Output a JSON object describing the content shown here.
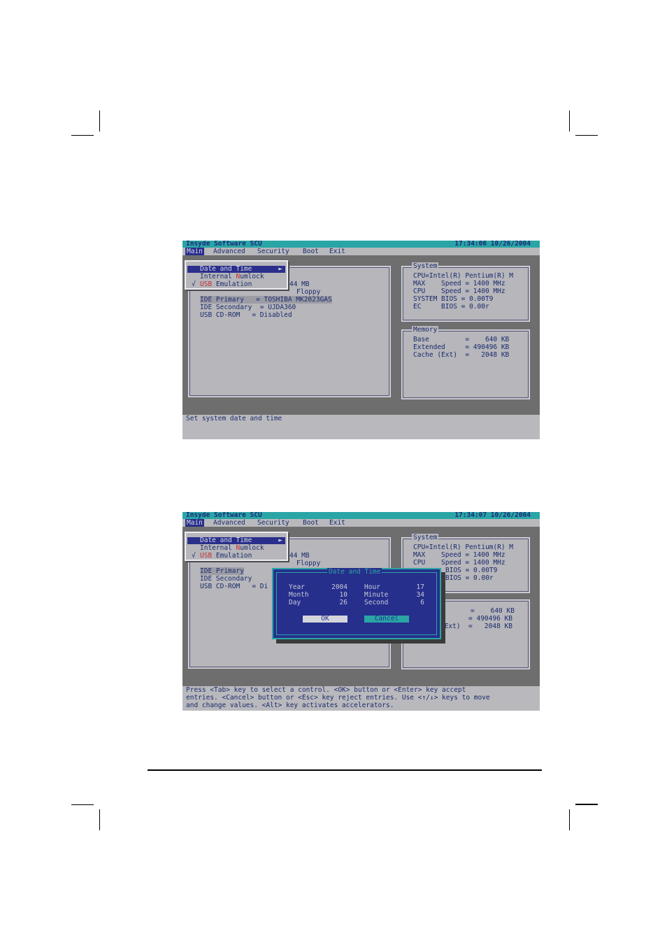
{
  "screens": [
    {
      "app_title": "Insyde Software SCU",
      "clock": "17:34:06  10/26/2004",
      "menus": [
        "Main",
        "Advanced",
        "Security",
        "Boot",
        "Exit"
      ],
      "dropdown": {
        "items": [
          {
            "pre": "Date and Time",
            "hot": "",
            "post": ""
          },
          {
            "pre": "Internal ",
            "hot": "N",
            "post": "umlock"
          },
          {
            "pre": "",
            "hot": "USB",
            "post": " Emulation"
          }
        ],
        "check": "√",
        "submenu_arrow": "►"
      },
      "left_rows": [
        "44 MB",
        "Floppy",
        "IDE Primary   = TOSHIBA MK2023GAS",
        "IDE Secondary  = UJDA360",
        "USB CD-ROM   = Disabled"
      ],
      "system": {
        "title": "System",
        "rows": [
          "CPU=Intel(R) Pentium(R) M",
          "MAX    Speed = 1400 MHz",
          "CPU    Speed = 1400 MHz",
          "SYSTEM BIOS = 0.00T9",
          "EC     BIOS = 0.00r"
        ]
      },
      "memory": {
        "title": "Memory",
        "rows": [
          "Base         =    640 KB",
          "Extended     = 490496 KB",
          "Cache (Ext)  =   2048 KB"
        ]
      },
      "status_lines": [
        "Set system date and time"
      ]
    },
    {
      "app_title": "Insyde Software SCU",
      "clock": "17:34:07  10/26/2004",
      "menus": [
        "Main",
        "Advanced",
        "Security",
        "Boot",
        "Exit"
      ],
      "dropdown": {
        "items": [
          {
            "pre": "Date and Time",
            "hot": "",
            "post": ""
          },
          {
            "pre": "Internal ",
            "hot": "N",
            "post": "umlock"
          },
          {
            "pre": "",
            "hot": "USB",
            "post": " Emulation"
          }
        ],
        "check": "√",
        "submenu_arrow": "►"
      },
      "left_rows": [
        "44 MB",
        "Floppy",
        "IDE Primary",
        "IDE Secondary",
        "USB CD-ROM   = Di"
      ],
      "system": {
        "title": "System",
        "rows": [
          "CPU=Intel(R) Pentium(R) M",
          "MAX    Speed = 1400 MHz",
          "CPU    Speed = 1400 MHz",
          "BIOS = 0.00T9",
          "BIOS = 0.00r"
        ]
      },
      "memory": {
        "title": "",
        "rows": [
          "=    640 KB",
          "d      = 490496 KB",
          "(Ext)  =   2048 KB"
        ]
      },
      "dialog": {
        "title": "Date and Time",
        "fields": [
          {
            "label": "Year",
            "value": "2004"
          },
          {
            "label": "Month",
            "value": "10"
          },
          {
            "label": "Day",
            "value": "26"
          },
          {
            "label": "Hour",
            "value": "17"
          },
          {
            "label": "Minute",
            "value": "34"
          },
          {
            "label": "Second",
            "value": "6"
          }
        ],
        "ok_label": "OK",
        "cancel_label": "Cancel"
      },
      "status_lines": [
        "Press <Tab> key to select a control. <OK> button or <Enter> key accept",
        "entries. <Cancel> button or <Esc> key reject entries. Use <↑/↓> keys to move",
        "and change values. <Alt> key activates accelerators."
      ]
    }
  ]
}
